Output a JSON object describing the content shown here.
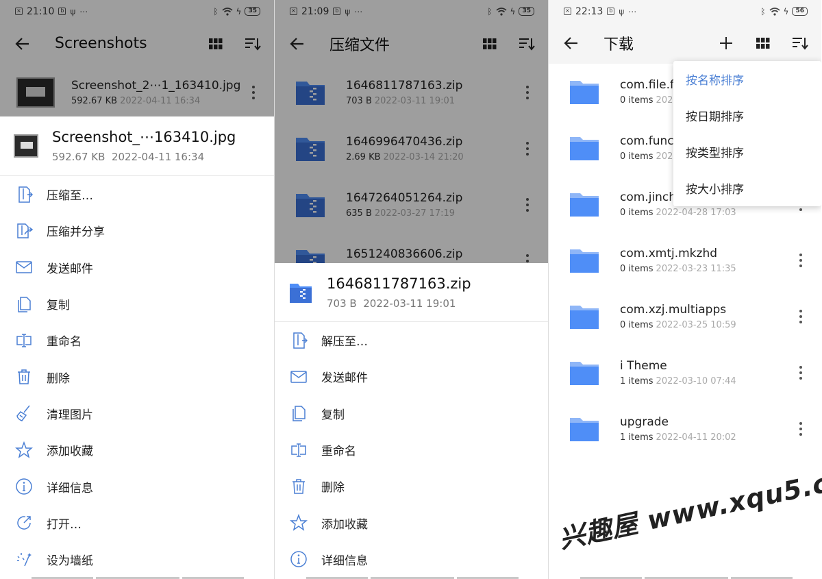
{
  "colors": {
    "accent": "#4a7fd4",
    "folder": "#4f8ef7",
    "zip": "#3b70d6"
  },
  "panel1": {
    "status": {
      "time": "21:10",
      "battery": "35"
    },
    "toolbar": {
      "title": "Screenshots"
    },
    "file": {
      "name": "Screenshot_2⋯1_163410.jpg",
      "size": "592.67 KB",
      "date": "2022-04-11 16:34"
    },
    "sheet": {
      "name": "Screenshot_⋯163410.jpg",
      "size": "592.67 KB",
      "date": "2022-04-11 16:34",
      "menu": [
        {
          "label": "压缩至…",
          "icon": "compress-to-icon"
        },
        {
          "label": "压缩并分享",
          "icon": "compress-share-icon"
        },
        {
          "label": "发送邮件",
          "icon": "mail-icon"
        },
        {
          "label": "复制",
          "icon": "copy-icon"
        },
        {
          "label": "重命名",
          "icon": "rename-icon"
        },
        {
          "label": "删除",
          "icon": "delete-icon"
        },
        {
          "label": "清理图片",
          "icon": "broom-icon"
        },
        {
          "label": "添加收藏",
          "icon": "star-icon"
        },
        {
          "label": "详细信息",
          "icon": "info-icon"
        },
        {
          "label": "打开…",
          "icon": "open-icon"
        },
        {
          "label": "设为墙纸",
          "icon": "wallpaper-icon"
        }
      ]
    }
  },
  "panel2": {
    "status": {
      "time": "21:09",
      "battery": "35"
    },
    "toolbar": {
      "title": "压缩文件"
    },
    "files": [
      {
        "name": "1646811787163.zip",
        "size": "703 B",
        "date": "2022-03-11 19:01"
      },
      {
        "name": "1646996470436.zip",
        "size": "2.69 KB",
        "date": "2022-03-14 21:20"
      },
      {
        "name": "1647264051264.zip",
        "size": "635 B",
        "date": "2022-03-27 17:19"
      },
      {
        "name": "1651240836606.zip",
        "size": "",
        "date": ""
      }
    ],
    "sheet": {
      "name": "1646811787163.zip",
      "size": "703 B",
      "date": "2022-03-11 19:01",
      "menu": [
        {
          "label": "解压至…",
          "icon": "extract-icon"
        },
        {
          "label": "发送邮件",
          "icon": "mail-icon"
        },
        {
          "label": "复制",
          "icon": "copy-icon"
        },
        {
          "label": "重命名",
          "icon": "rename-icon"
        },
        {
          "label": "删除",
          "icon": "delete-icon"
        },
        {
          "label": "添加收藏",
          "icon": "star-icon"
        },
        {
          "label": "详细信息",
          "icon": "info-icon"
        }
      ]
    }
  },
  "panel3": {
    "status": {
      "time": "22:13",
      "battery": "56"
    },
    "toolbar": {
      "title": "下载"
    },
    "folders": [
      {
        "name": "com.file.f",
        "count": "0 items",
        "date": "202"
      },
      {
        "name": "com.func",
        "count": "0 items",
        "date": "202"
      },
      {
        "name": "com.jinch",
        "count": "0 items",
        "date": "2022-04-28 17:03"
      },
      {
        "name": "com.xmtj.mkzhd",
        "count": "0 items",
        "date": "2022-03-23 11:35"
      },
      {
        "name": "com.xzj.multiapps",
        "count": "0 items",
        "date": "2022-03-25 10:59"
      },
      {
        "name": "i Theme",
        "count": "1 items",
        "date": "2022-03-10 07:44"
      },
      {
        "name": "upgrade",
        "count": "1 items",
        "date": "2022-04-11 20:02"
      }
    ],
    "sort_menu": [
      {
        "label": "按名称排序",
        "active": true
      },
      {
        "label": "按日期排序",
        "active": false
      },
      {
        "label": "按类型排序",
        "active": false
      },
      {
        "label": "按大小排序",
        "active": false
      }
    ]
  },
  "watermark": "兴趣屋 www.xqu5.com"
}
